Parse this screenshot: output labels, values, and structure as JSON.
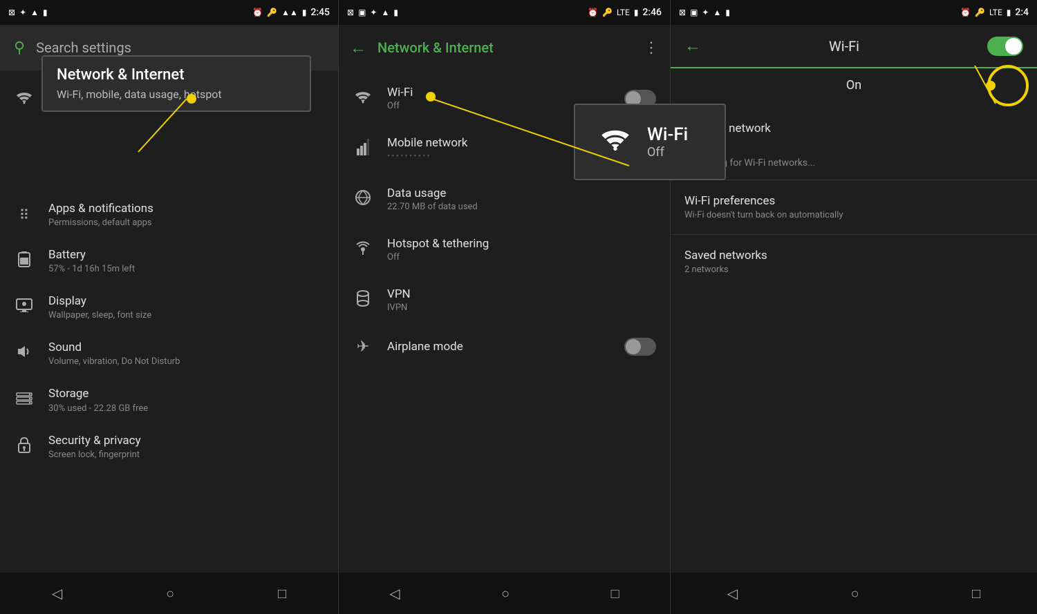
{
  "panel1": {
    "status": {
      "time": "2:45",
      "icons": [
        "voicemail",
        "signal",
        "wifi",
        "battery"
      ]
    },
    "search": {
      "placeholder": "Search settings"
    },
    "tooltip": {
      "title": "Network & Internet",
      "subtitle": "Wi-Fi, mobile, data usage, hotspot"
    },
    "items": [
      {
        "id": "network",
        "icon": "wifi",
        "title": "Network & Internet",
        "subtitle": "Wi-Fi, mobile, data usage, hotspot"
      },
      {
        "id": "apps",
        "icon": "apps",
        "title": "Apps & notifications",
        "subtitle": "Permissions, default apps"
      },
      {
        "id": "battery",
        "icon": "battery",
        "title": "Battery",
        "subtitle": "57% - 1d 16h 15m left"
      },
      {
        "id": "display",
        "icon": "display",
        "title": "Display",
        "subtitle": "Wallpaper, sleep, font size"
      },
      {
        "id": "sound",
        "icon": "sound",
        "title": "Sound",
        "subtitle": "Volume, vibration, Do Not Disturb"
      },
      {
        "id": "storage",
        "icon": "storage",
        "title": "Storage",
        "subtitle": "30% used - 22.28 GB free"
      },
      {
        "id": "security",
        "icon": "security",
        "title": "Security & privacy",
        "subtitle": "Screen lock, fingerprint"
      }
    ],
    "nav": {
      "back": "◁",
      "home": "○",
      "recent": "□"
    }
  },
  "panel2": {
    "status": {
      "time": "2:46"
    },
    "header": {
      "title": "Network & Internet"
    },
    "items": [
      {
        "id": "wifi",
        "icon": "wifi",
        "title": "Wi-Fi",
        "subtitle": "Off",
        "toggle": "off"
      },
      {
        "id": "mobile",
        "icon": "signal",
        "title": "Mobile network",
        "subtitle": "••••••••••",
        "toggle": null
      },
      {
        "id": "data",
        "icon": "data",
        "title": "Data usage",
        "subtitle": "22.70 MB of data used",
        "toggle": null
      },
      {
        "id": "hotspot",
        "icon": "hotspot",
        "title": "Hotspot & tethering",
        "subtitle": "Off",
        "toggle": null
      },
      {
        "id": "vpn",
        "icon": "vpn",
        "title": "VPN",
        "subtitle": "IVPN",
        "toggle": null
      },
      {
        "id": "airplane",
        "icon": "airplane",
        "title": "Airplane mode",
        "subtitle": null,
        "toggle": "off"
      }
    ],
    "wifi_popup": {
      "title": "Wi-Fi",
      "subtitle": "Off"
    },
    "nav": {
      "back": "◁",
      "home": "○",
      "recent": "□"
    }
  },
  "panel3": {
    "status": {
      "time": "2:4"
    },
    "header": {
      "title": "Wi-Fi",
      "toggle_state": "On"
    },
    "add_network": "Add network",
    "searching": "Searching for Wi-Fi networks...",
    "preferences": {
      "title": "Wi-Fi preferences",
      "subtitle": "Wi-Fi doesn't turn back on automatically"
    },
    "saved": {
      "title": "Saved networks",
      "subtitle": "2 networks"
    },
    "nav": {
      "back": "◁",
      "home": "○",
      "recent": "□"
    }
  }
}
